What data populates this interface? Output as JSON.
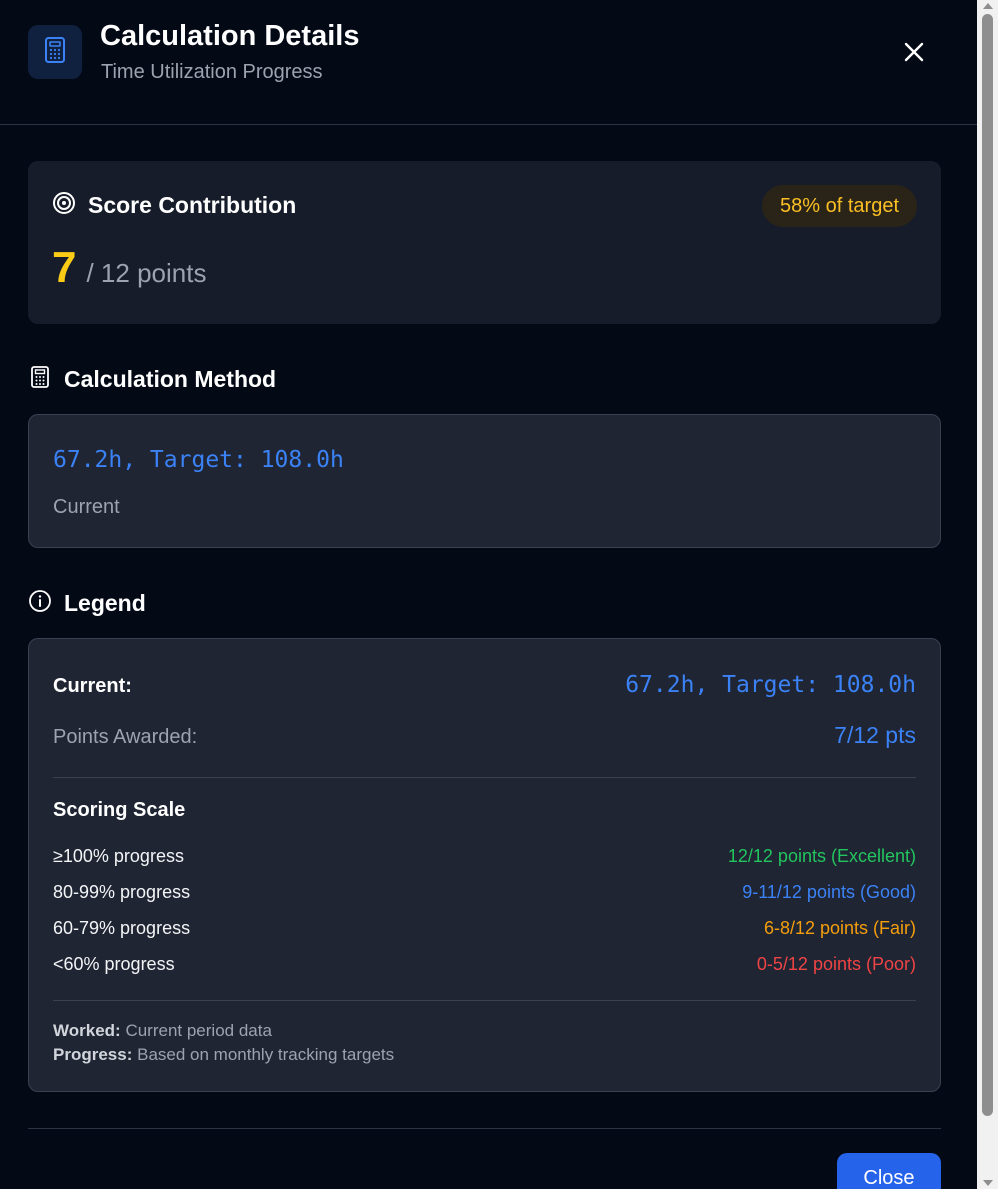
{
  "header": {
    "title": "Calculation Details",
    "subtitle": "Time Utilization Progress",
    "icon": "calculator-icon",
    "close_icon": "close-icon"
  },
  "score": {
    "title": "Score Contribution",
    "icon": "target-icon",
    "value": "7",
    "max_text": "/ 12 points",
    "badge": "58% of target"
  },
  "method": {
    "heading": "Calculation Method",
    "icon": "calculator-icon",
    "formula": "67.2h, Target: 108.0h",
    "description": "Current"
  },
  "legend": {
    "heading": "Legend",
    "icon": "info-icon",
    "current_label": "Current:",
    "current_value": "67.2h, Target: 108.0h",
    "points_label": "Points Awarded:",
    "points_value": "7/12 pts",
    "scale_title": "Scoring Scale",
    "scale": [
      {
        "range": "≥100% progress",
        "points": "12/12 points (Excellent)",
        "color": "#22c55e"
      },
      {
        "range": "80-99% progress",
        "points": "9-11/12 points (Good)",
        "color": "#3b82f6"
      },
      {
        "range": "60-79% progress",
        "points": "6-8/12 points (Fair)",
        "color": "#f59e0b"
      },
      {
        "range": "<60% progress",
        "points": "0-5/12 points (Poor)",
        "color": "#ef4444"
      }
    ],
    "notes": [
      {
        "label": "Worked:",
        "text": "Current period data"
      },
      {
        "label": "Progress:",
        "text": "Based on monthly tracking targets"
      }
    ]
  },
  "footer": {
    "close_label": "Close"
  },
  "colors": {
    "accent": "#3b82f6",
    "score": "#facc15",
    "badge_text": "#fbbf24"
  }
}
